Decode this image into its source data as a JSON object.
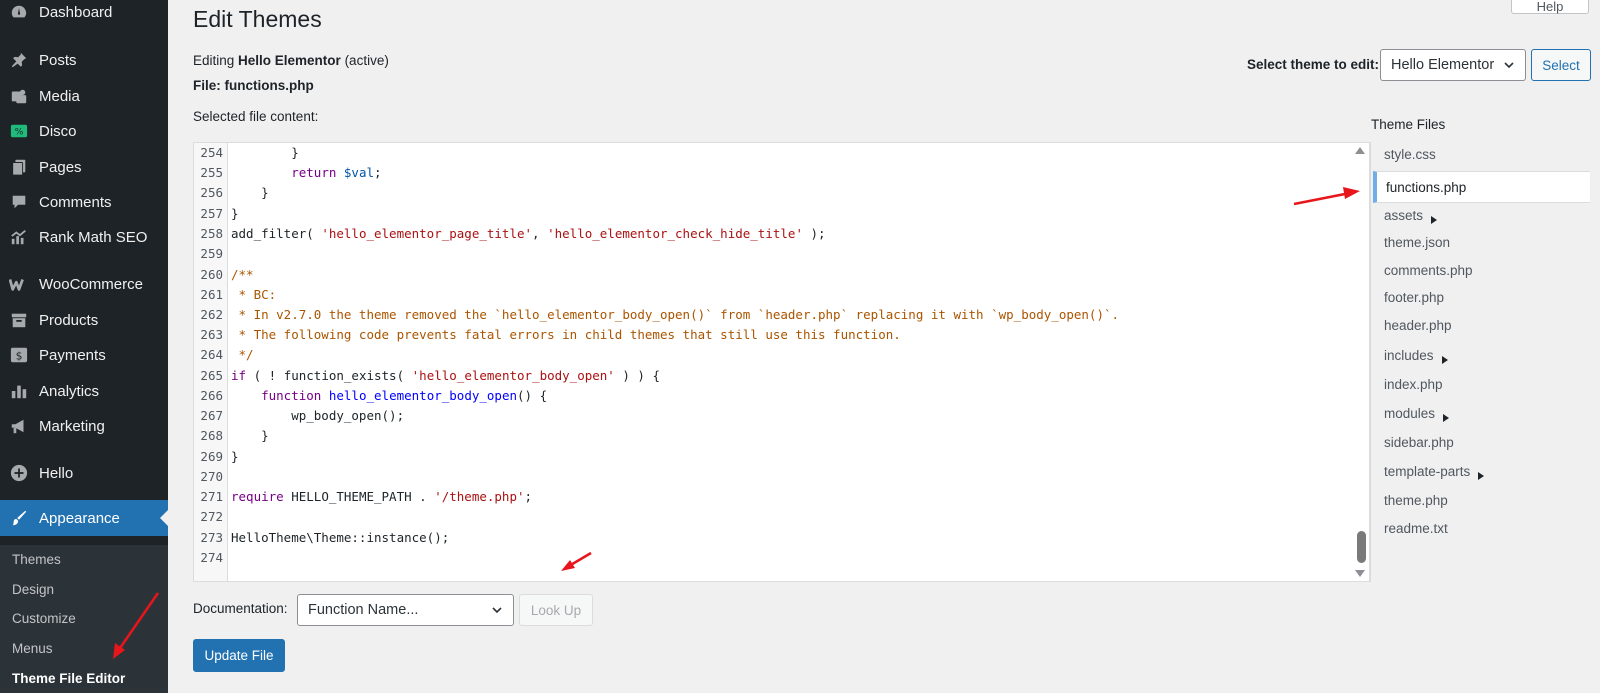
{
  "sidebar": {
    "items": [
      {
        "label": "Dashboard",
        "icon": "dashboard-icon"
      },
      {
        "label": "Posts",
        "icon": "pushpin-icon"
      },
      {
        "label": "Media",
        "icon": "media-icon"
      },
      {
        "label": "Disco",
        "icon": "disco-icon"
      },
      {
        "label": "Pages",
        "icon": "pages-icon"
      },
      {
        "label": "Comments",
        "icon": "comment-icon"
      },
      {
        "label": "Rank Math SEO",
        "icon": "chart-icon"
      },
      {
        "label": "WooCommerce",
        "icon": "woocommerce-icon"
      },
      {
        "label": "Products",
        "icon": "archive-icon"
      },
      {
        "label": "Payments",
        "icon": "dollar-icon"
      },
      {
        "label": "Analytics",
        "icon": "bar-chart-icon"
      },
      {
        "label": "Marketing",
        "icon": "megaphone-icon"
      },
      {
        "label": "Hello",
        "icon": "plus-circle-icon"
      },
      {
        "label": "Appearance",
        "icon": "brush-icon"
      }
    ],
    "submenu": [
      "Themes",
      "Design",
      "Customize",
      "Menus",
      "Theme File Editor"
    ]
  },
  "page": {
    "title": "Edit Themes",
    "help_label": "Help",
    "editing_prefix": "Editing ",
    "editing_theme": "Hello Elementor",
    "editing_suffix": " (active)",
    "file_line": "File: functions.php",
    "selected_label": "Selected file content:",
    "select_theme_label": "Select theme to edit:",
    "select_theme_value": "Hello Elementor",
    "select_button": "Select",
    "files_heading": "Theme Files",
    "doc_label": "Documentation:",
    "doc_placeholder": "Function Name...",
    "lookup_button": "Look Up",
    "update_button": "Update File"
  },
  "code": {
    "line_numbers": [
      "254",
      "255",
      "256",
      "257",
      "258",
      "259",
      "260",
      "261",
      "262",
      "263",
      "264",
      "265",
      "266",
      "267",
      "268",
      "269",
      "270",
      "271",
      "272",
      "273",
      "274"
    ],
    "l254": "        }",
    "l255_kw": "return",
    "l255_var": "$val",
    "l255_end": ";",
    "l256": "    }",
    "l257": "}",
    "l258_a": "add_filter( ",
    "l258_s1": "'hello_elementor_page_title'",
    "l258_b": ", ",
    "l258_s2": "'hello_elementor_check_hide_title'",
    "l258_c": " );",
    "l260": "/**",
    "l261": " * BC:",
    "l262": " * In v2.7.0 the theme removed the `hello_elementor_body_open()` from `header.php` replacing it with `wp_body_open()`.",
    "l263": " * The following code prevents fatal errors in child themes that still use this function.",
    "l264": " */",
    "l265_kw": "if",
    "l265_a": " ( ! function_exists( ",
    "l265_s": "'hello_elementor_body_open'",
    "l265_b": " ) ) {",
    "l266_kw": "function",
    "l266_fn": "hello_elementor_body_open",
    "l266_b": "() {",
    "l267": "        wp_body_open();",
    "l268": "    }",
    "l269": "}",
    "l271_kw": "require",
    "l271_a": " HELLO_THEME_PATH . ",
    "l271_s": "'/theme.php'",
    "l271_b": ";",
    "l273": "HelloTheme\\Theme::instance();"
  },
  "theme_files": [
    {
      "name": "style.css"
    },
    {
      "name": "functions.php",
      "current": true
    },
    {
      "name": "assets",
      "folder": true
    },
    {
      "name": "theme.json"
    },
    {
      "name": "comments.php"
    },
    {
      "name": "footer.php"
    },
    {
      "name": "header.php"
    },
    {
      "name": "includes",
      "folder": true
    },
    {
      "name": "index.php"
    },
    {
      "name": "modules",
      "folder": true
    },
    {
      "name": "sidebar.php"
    },
    {
      "name": "template-parts",
      "folder": true
    },
    {
      "name": "theme.php"
    },
    {
      "name": "readme.txt"
    }
  ],
  "colors": {
    "sidebar_bg": "#1d2327",
    "submenu_bg": "#2c3338",
    "accent": "#2271b1",
    "annotation_arrow": "#e8151b"
  }
}
